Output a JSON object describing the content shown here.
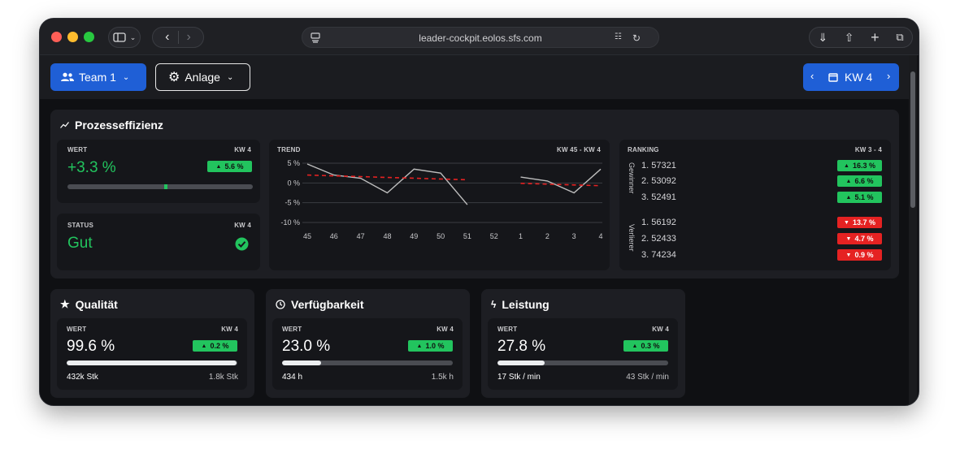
{
  "browser": {
    "url": "leader-cockpit.eolos.sfs.com"
  },
  "header": {
    "team_label": "Team 1",
    "anlage_label": "Anlage",
    "week_label": "KW 4"
  },
  "prozesseffizienz": {
    "title": "Prozesseffizienz",
    "wert": {
      "label": "WERT",
      "week": "KW 4",
      "value": "+3.3 %",
      "badge": "5.6 %",
      "bar_marker_fraction": 0.52
    },
    "status": {
      "label": "STATUS",
      "week": "KW 4",
      "value": "Gut"
    },
    "trend": {
      "label": "TREND",
      "range": "KW 45 - KW 4"
    },
    "ranking": {
      "label": "RANKING",
      "range": "KW 3 - 4",
      "gewinner_label": "Gewinner",
      "verlierer_label": "Verlierer",
      "gewinner": [
        {
          "rank": "1.",
          "id": "57321",
          "badge": "16.3 %"
        },
        {
          "rank": "2.",
          "id": "53092",
          "badge": "6.6 %"
        },
        {
          "rank": "3.",
          "id": "52491",
          "badge": "5.1 %"
        }
      ],
      "verlierer": [
        {
          "rank": "1.",
          "id": "56192",
          "badge": "13.7 %"
        },
        {
          "rank": "2.",
          "id": "52433",
          "badge": "4.7 %"
        },
        {
          "rank": "3.",
          "id": "74234",
          "badge": "0.9 %"
        }
      ]
    }
  },
  "chart_data": {
    "type": "line",
    "x": [
      "45",
      "46",
      "47",
      "48",
      "49",
      "50",
      "51",
      "52",
      "1",
      "2",
      "3",
      "4"
    ],
    "y_ticks": [
      "5 %",
      "0 %",
      "-5 %",
      "-10 %"
    ],
    "ylim": [
      -10,
      5
    ],
    "series": [
      {
        "values": [
          4.8,
          2.0,
          1.2,
          -2.5,
          3.5,
          2.5,
          -5.5,
          null,
          1.5,
          0.5,
          -2.5,
          3.5
        ],
        "color": "#bdbdbd"
      },
      {
        "values": [
          2.0,
          1.8,
          1.6,
          1.4,
          1.2,
          1.0,
          0.8,
          null,
          -0.1,
          -0.3,
          -0.5,
          -0.7
        ],
        "color": "#e52222",
        "dashed": true
      }
    ]
  },
  "qualitaet": {
    "title": "Qualität",
    "label": "WERT",
    "week": "KW 4",
    "value": "99.6 %",
    "badge": "0.2 %",
    "progress": 0.996,
    "left": "432k Stk",
    "right": "1.8k Stk"
  },
  "verfuegbarkeit": {
    "title": "Verfügbarkeit",
    "label": "WERT",
    "week": "KW 4",
    "value": "23.0 %",
    "badge": "1.0 %",
    "progress": 0.23,
    "left": "434 h",
    "right": "1.5k h"
  },
  "leistung": {
    "title": "Leistung",
    "label": "WERT",
    "week": "KW 4",
    "value": "27.8 %",
    "badge": "0.3 %",
    "progress": 0.278,
    "left": "17 Stk / min",
    "right": "43 Stk / min"
  },
  "colors": {
    "green": "#22c45e",
    "red": "#e52222",
    "blue": "#1f5fd6"
  }
}
